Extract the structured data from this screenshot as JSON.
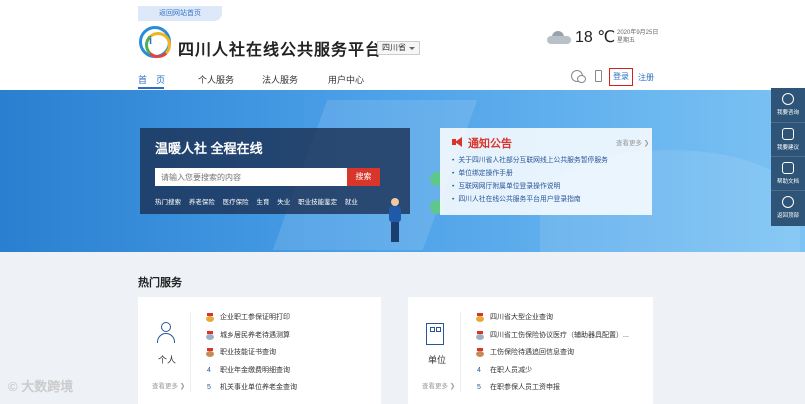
{
  "header": {
    "back_home": "返回网站首页",
    "logo_text": "i",
    "site_title": "四川人社在线公共服务平台",
    "province": "四川省",
    "temperature": "18 ℃",
    "date": "2020年9月25日",
    "weekday": "星期五",
    "login": "登录",
    "register": "注册"
  },
  "nav": [
    {
      "label": "首　页",
      "active": true
    },
    {
      "label": "个人服务"
    },
    {
      "label": "法人服务"
    },
    {
      "label": "用户中心"
    }
  ],
  "banner": {
    "slogan": "温暖人社 全程在线",
    "search_placeholder": "请输入您要搜索的内容",
    "search_button": "搜索",
    "hot_searches": [
      "热门搜索",
      "养老保险",
      "医疗保险",
      "生育",
      "失业",
      "职业技能鉴定",
      "就业"
    ]
  },
  "notice": {
    "title": "通知公告",
    "more": "查看更多 ❯",
    "items": [
      "关于四川省人社部分互联网线上公共服务暂停服务",
      "单位绑定操作手册",
      "互联网网厅附属单位登录操作说明",
      "四川人社在线公共服务平台用户登录指南"
    ]
  },
  "sidebar": {
    "items": [
      "我要咨询",
      "我要建议",
      "帮助文档",
      "返回顶部"
    ]
  },
  "services": {
    "section_title": "热门服务",
    "personal": {
      "name": "个人",
      "more": "查看更多 ❯",
      "items": [
        "企业职工参保证明打印",
        "城乡居民养老待遇测算",
        "职业技能证书查询",
        "职业年金缴费明细查询",
        "机关事业单位养老金查询"
      ]
    },
    "unit": {
      "name": "单位",
      "more": "查看更多 ❯",
      "items": [
        "四川省大型企业查询",
        "四川省工伤保险协议医疗（辅助器具配置）...",
        "工伤保险待遇追回信息查询",
        "在职人员减少",
        "在职参保人员工资申报"
      ]
    }
  },
  "watermark": "© 大数跨境"
}
